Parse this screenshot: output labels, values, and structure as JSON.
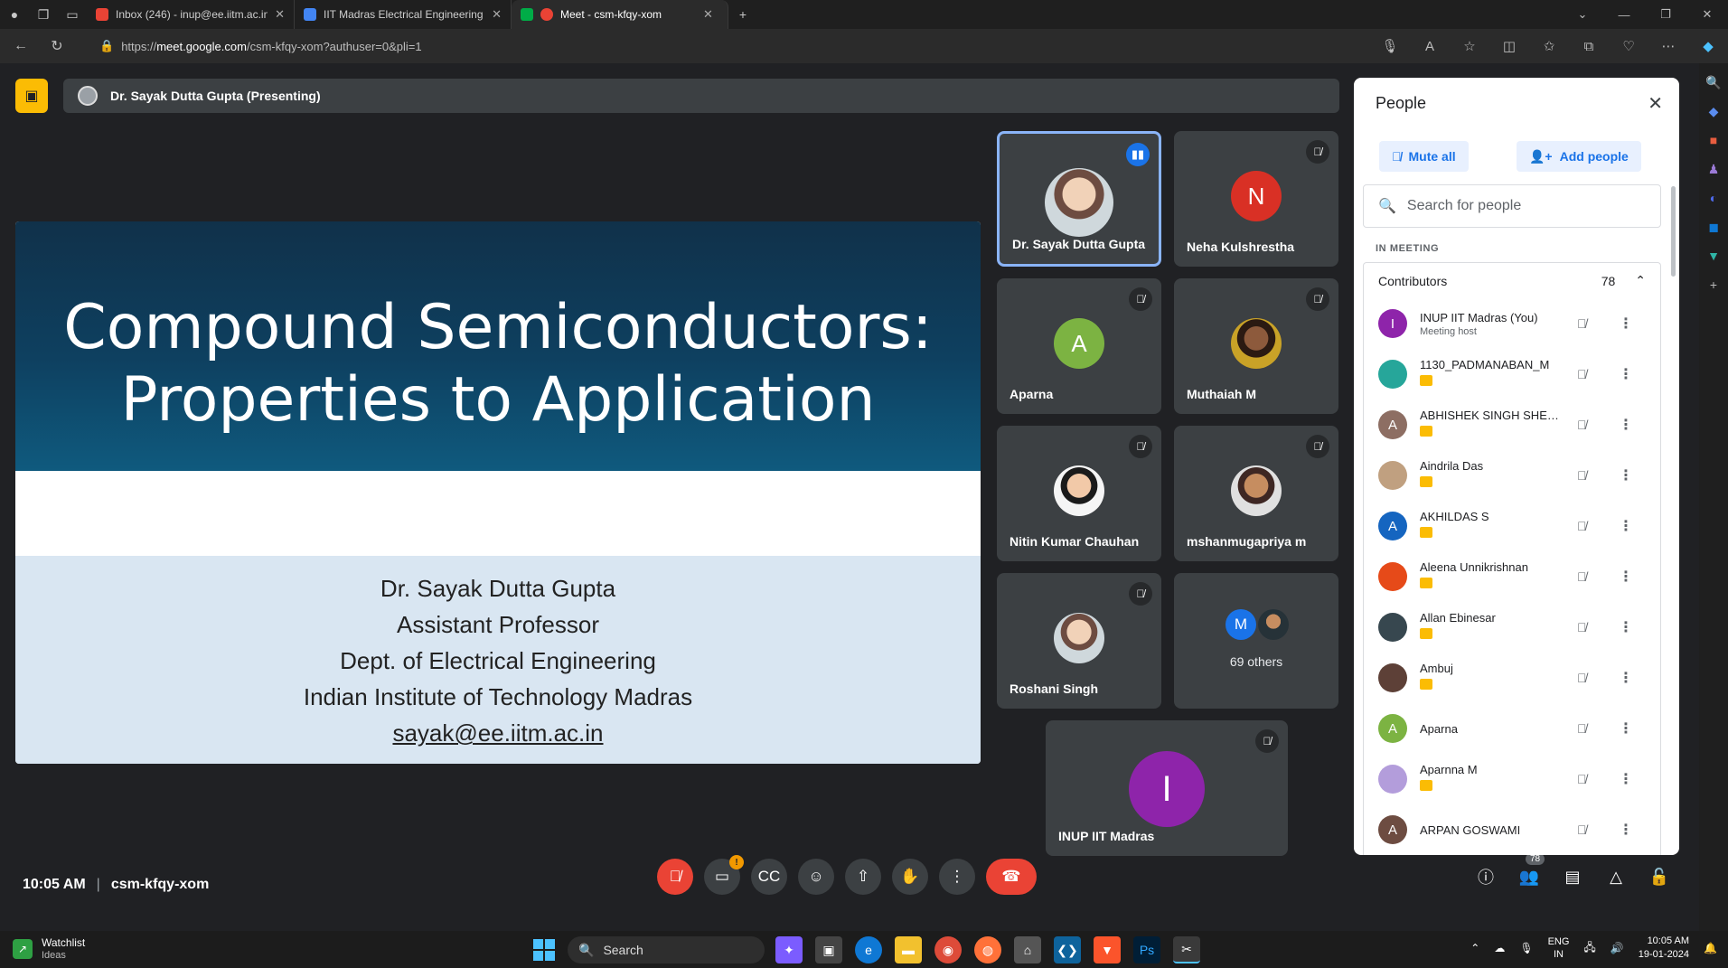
{
  "browser": {
    "tabs": [
      {
        "label": "Inbox (246) - inup@ee.iitm.ac.in",
        "icon": "gmail-icon",
        "color": "#ea4335"
      },
      {
        "label": "IIT Madras Electrical Engineering",
        "icon": "calendar-icon",
        "color": "#4285f4"
      },
      {
        "label": "Meet - csm-kfqy-xom",
        "icon": "meet-icon",
        "color": "#00ac47"
      }
    ],
    "url_prefix": "https://",
    "url_host": "meet.google.com",
    "url_path": "/csm-kfqy-xom?authuser=0&pli=1"
  },
  "meet": {
    "presenter_bar": "Dr. Sayak Dutta Gupta (Presenting)",
    "slide": {
      "title_line1": "Compound Semiconductors:",
      "title_line2": "Properties to Application",
      "name": "Dr. Sayak Dutta Gupta",
      "role": "Assistant Professor",
      "dept": "Dept. of Electrical Engineering",
      "institute": "Indian Institute of Technology Madras",
      "email": "sayak@ee.iitm.ac.in"
    },
    "tiles": [
      {
        "name": "Dr. Sayak Dutta Gupta"
      },
      {
        "name": "Neha Kulshrestha",
        "initial": "N",
        "color": "#d93025"
      },
      {
        "name": "Aparna",
        "initial": "A",
        "color": "#7cb342"
      },
      {
        "name": "Muthaiah M"
      },
      {
        "name": "Nitin Kumar Chauhan"
      },
      {
        "name": "mshanmugapriya m"
      },
      {
        "name": "Roshani Singh"
      },
      {
        "others_label": "69 others",
        "initial": "M",
        "color": "#1a73e8"
      },
      {
        "name": "INUP IIT Madras",
        "initial": "I",
        "color": "#8e24aa"
      }
    ],
    "time": "10:05 AM",
    "meeting_code": "csm-kfqy-xom",
    "people_count": "78"
  },
  "people_panel": {
    "title": "People",
    "mute_all": "Mute all",
    "add_people": "Add people",
    "search_placeholder": "Search for people",
    "section": "IN MEETING",
    "group": "Contributors",
    "group_count": "78",
    "participants": [
      {
        "name": "INUP IIT Madras (You)",
        "sub": "Meeting host",
        "initial": "I",
        "color": "#8e24aa"
      },
      {
        "name": "1130_PADMANABAN_M",
        "initial": "",
        "color": "#26a69a"
      },
      {
        "name": "ABHISHEK SINGH SHEK...",
        "initial": "A",
        "color": "#8d6e63"
      },
      {
        "name": "Aindrila Das",
        "initial": "",
        "color": "#c0a080"
      },
      {
        "name": "AKHILDAS S",
        "initial": "A",
        "color": "#1565c0"
      },
      {
        "name": "Aleena Unnikrishnan",
        "initial": "",
        "color": "#e64a19"
      },
      {
        "name": "Allan Ebinesar",
        "initial": "",
        "color": "#37474f"
      },
      {
        "name": "Ambuj",
        "initial": "",
        "color": "#5d4037"
      },
      {
        "name": "Aparna",
        "initial": "A",
        "color": "#7cb342"
      },
      {
        "name": "Aparnna M",
        "initial": "",
        "color": "#b39ddb"
      },
      {
        "name": "ARPAN GOSWAMI",
        "initial": "A",
        "color": "#6d4c41"
      }
    ]
  },
  "taskbar": {
    "widget_title": "Watchlist",
    "widget_sub": "Ideas",
    "search": "Search",
    "lang1": "ENG",
    "lang2": "IN",
    "time": "10:05 AM",
    "date": "19-01-2024"
  }
}
